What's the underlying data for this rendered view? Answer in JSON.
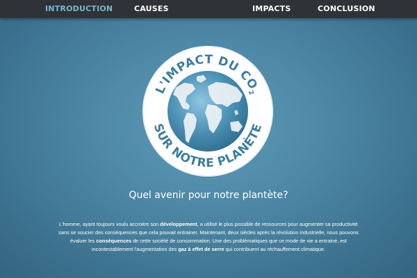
{
  "nav": {
    "items": [
      {
        "label": "INTRODUCTION",
        "active": true
      },
      {
        "label": "CAUSES",
        "active": false
      },
      {
        "label": "IMPACTS",
        "active": false
      },
      {
        "label": "CONCLUSION",
        "active": false
      }
    ]
  },
  "logo": {
    "top_text": "L'IMPACT DU CO",
    "top_subscript": "2",
    "bottom_text": "SUR NOTRE PLANÈTE",
    "icon": "globe-icon"
  },
  "main": {
    "question": "Quel avenir pour notre plantète?",
    "paragraph": {
      "p1": "L'homme, ayant toujours voulu accroitre son ",
      "p1_strong": "développement",
      "p2": ", a utilisé le plus possible de ressources pour augmenter sa productivité sans se soucier des conséquences que cela pouvait entrainer. Maintenant, deux siècles après la révolution industrielle, nous pouvons évaluer les ",
      "p2_strong": "conséquences",
      "p3": " de cette société de consommation. Une des problématiques que ce mode de vie a entrainé, est incontestablement l'augmentation des ",
      "p3_strong": "gaz à effet de serre",
      "p4": " qui contribuent au réchauffement climatique."
    }
  },
  "colors": {
    "nav_bg": "#2f3236",
    "nav_active": "#78b8d6",
    "background": "#4f8aa8",
    "logo_text": "#3e7d9d",
    "ring": "#ffffff"
  }
}
